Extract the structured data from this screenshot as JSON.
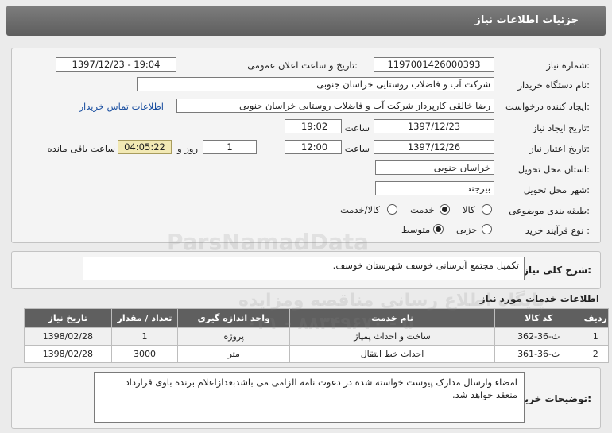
{
  "header": {
    "title": "جزئیات اطلاعات نیاز"
  },
  "form": {
    "need_number_label": "شماره نیاز:",
    "need_number": "1197001426000393",
    "announce_label": "تاریخ و ساعت اعلان عمومی:",
    "announce_value": "1397/12/23 - 19:04",
    "buyer_label": "نام دستگاه خریدار:",
    "buyer_value": "شرکت آب و فاضلاب روستایی خراسان جنوبی",
    "creator_label": "ایجاد کننده درخواست:",
    "creator_value": "رضا  خالقی کارپرداز شرکت آب و فاضلاب روستایی خراسان جنوبی",
    "contact_link": "اطلاعات تماس خریدار",
    "created_date_label": "تاریخ ایجاد نیاز:",
    "created_date": "1397/12/23",
    "time_label": "ساعت",
    "created_time": "19:02",
    "validity_label": "تاریخ اعتبار نیاز:",
    "validity_date": "1397/12/26",
    "validity_time": "12:00",
    "days_value": "1",
    "days_label": "روز و",
    "remaining_time": "04:05:22",
    "remaining_label": "ساعت باقی مانده",
    "province_label": "استان محل تحویل:",
    "province_value": "خراسان جنوبی",
    "city_label": "شهر محل تحویل:",
    "city_value": "بیرجند",
    "category_label": "طبقه بندی موضوعی:",
    "category_options": [
      "کالا",
      "خدمت",
      "کالا/خدمت"
    ],
    "category_selected": "خدمت",
    "process_label": "نوع فرآیند خرید :",
    "process_options": [
      "جزیی",
      "متوسط"
    ],
    "process_selected": "متوسط"
  },
  "summary": {
    "label": "شرح کلی نیاز:",
    "value": "تکمیل مجتمع آبرسانی خوسف شهرستان خوسف."
  },
  "services": {
    "title": "اطلاعات خدمات مورد نیاز",
    "columns": [
      "ردیف",
      "کد کالا",
      "نام خدمت",
      "واحد اندازه گیری",
      "تعداد / مقدار",
      "تاریخ نیاز"
    ],
    "rows": [
      [
        "1",
        "ث-36-362",
        "ساخت و احداث پمپاژ",
        "پروژه",
        "1",
        "1398/02/28"
      ],
      [
        "2",
        "ث-36-361",
        "احداث خط انتقال",
        "متر",
        "3000",
        "1398/02/28"
      ]
    ]
  },
  "notes": {
    "label": "توضیحات خریدار:",
    "value": "امضاء وارسال مدارک پیوست  خواسته شده در دعوت نامه الزامی می باشدبعدازاعلام برنده باوی قرارداد منعقد خواهد شد."
  },
  "watermark": {
    "brand": "ParsNamadData",
    "line1": "پایگاه اطلاع رسانی مناقصه ومزایده",
    "line2": "۰۲۱ - ۸۸۳۴۹۶۷۰ - ۵"
  }
}
